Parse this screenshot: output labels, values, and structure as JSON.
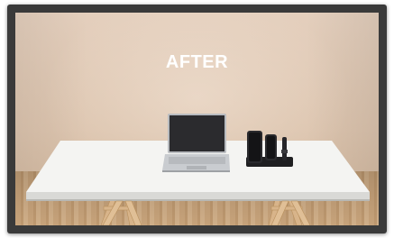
{
  "image": {
    "title": "AFTER"
  },
  "colors": {
    "wall": "#dcc4ae",
    "tabletop": "#f2f2f0",
    "floor": "#c6a27a",
    "frame": "#3a3a3a",
    "title_text": "#ffffff"
  }
}
